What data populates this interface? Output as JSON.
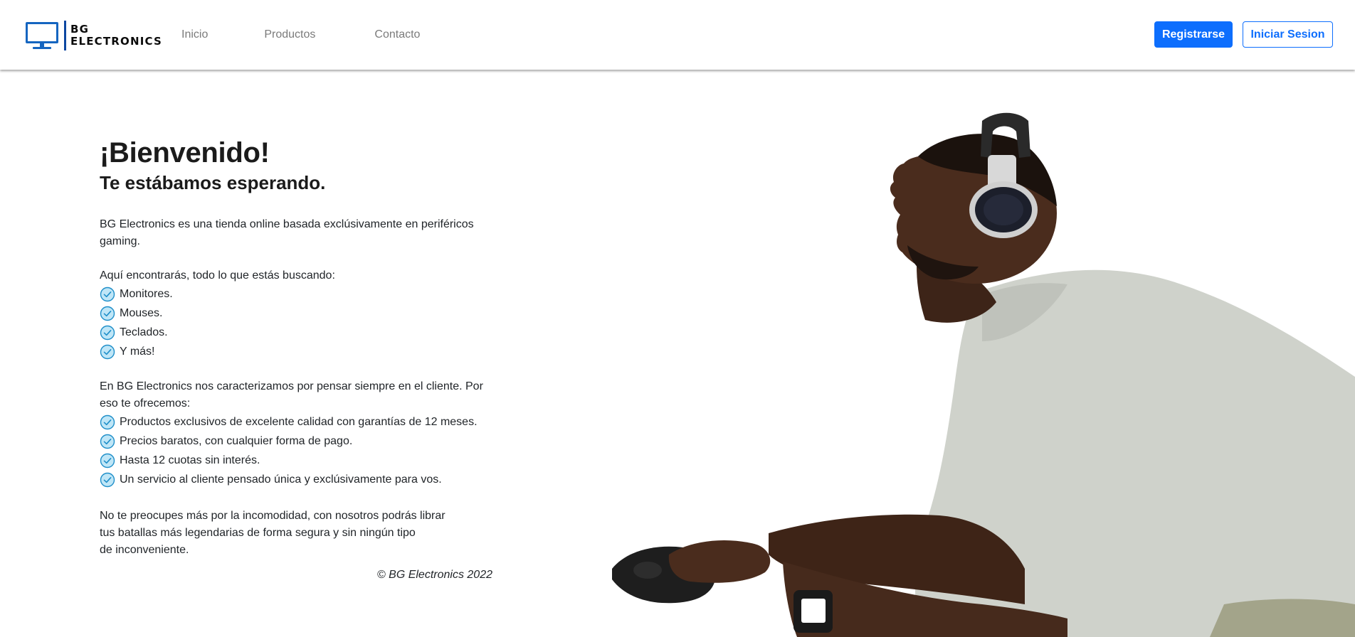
{
  "brand": {
    "line1": "BG",
    "line2": "ELECTRONICS"
  },
  "nav": {
    "items": [
      "Inicio",
      "Productos",
      "Contacto"
    ]
  },
  "auth": {
    "register_label": "Registrarse",
    "login_label": "Iniciar Sesion"
  },
  "hero": {
    "title": "¡Bienvenido!",
    "subtitle": "Te estábamos esperando.",
    "intro": "BG Electronics es una tienda online basada exclúsivamente en periféricos gaming.",
    "find_heading": "Aquí encontrarás, todo lo que estás buscando:",
    "find_items": [
      "Monitores.",
      "Mouses.",
      "Teclados.",
      "Y más!"
    ],
    "offer_heading": "En BG Electronics nos caracterizamos por pensar siempre en el cliente. Por eso te ofrecemos:",
    "offer_items": [
      "Productos exclusivos de excelente calidad con garantías de 12 meses.",
      "Precios baratos, con cualquier forma de pago.",
      "Hasta 12 cuotas sin interés.",
      "Un servicio al cliente pensado única y exclúsivamente para vos."
    ],
    "closing_line1": "No te preocupes más por la incomodidad, con nosotros podrás librar",
    "closing_line2": "tus batallas más legendarias de forma segura y sin ningún tipo",
    "closing_line3": "de inconveniente.",
    "copyright": "© BG Electronics 2022"
  },
  "colors": {
    "primary": "#0d6efd",
    "check_fill": "#bfe6f7",
    "check_stroke": "#1f8fc9"
  }
}
